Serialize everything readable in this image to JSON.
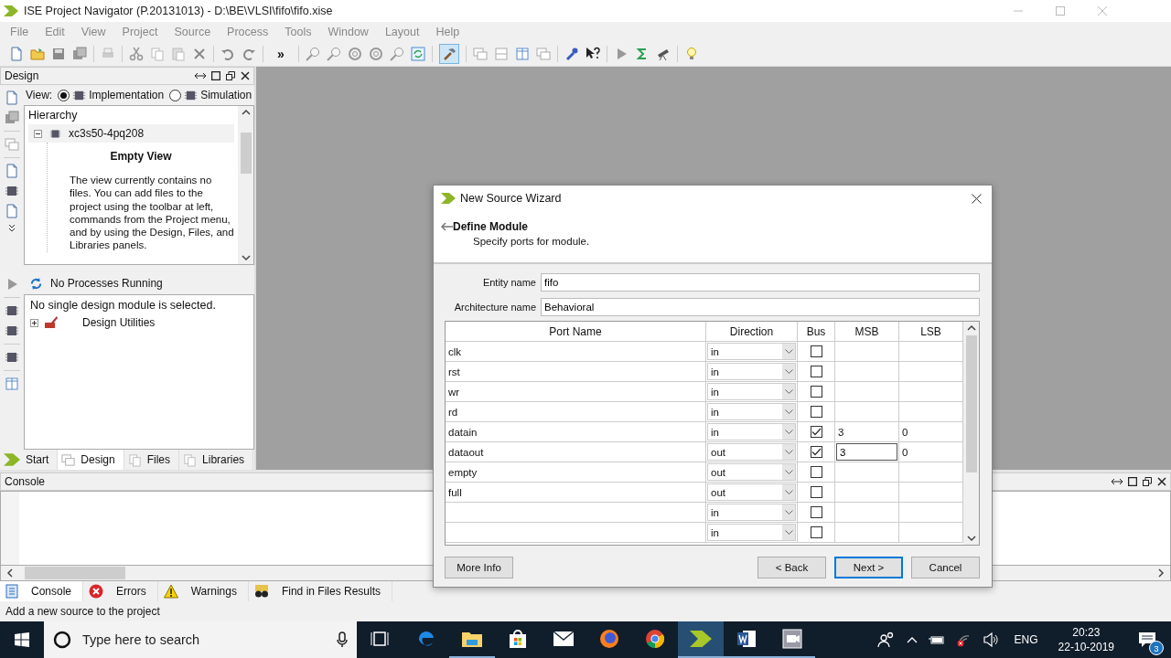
{
  "window": {
    "title": "ISE Project Navigator (P.20131013) - D:\\BE\\VLSI\\fifo\\fifo.xise"
  },
  "menu": [
    "File",
    "Edit",
    "View",
    "Project",
    "Source",
    "Process",
    "Tools",
    "Window",
    "Layout",
    "Help"
  ],
  "toolbar": {
    "overflow": "»"
  },
  "design_panel": {
    "title": "Design",
    "view_label": "View:",
    "view_options": [
      {
        "label": "Implementation",
        "selected": true
      },
      {
        "label": "Simulation",
        "selected": false
      }
    ],
    "hierarchy": {
      "title": "Hierarchy",
      "root": {
        "label": "xc3s50-4pq208",
        "expanded": true
      }
    },
    "empty_view": {
      "title": "Empty View",
      "text": "The view currently contains no files. You can add files to the project using the toolbar at left, commands from the Project menu, and by using the Design, Files, and Libraries panels."
    }
  },
  "processes": {
    "status": "No Processes Running",
    "message": "No single design module is selected.",
    "items": [
      {
        "label": "Design Utilities",
        "expanded": false
      }
    ]
  },
  "panel_tabs": [
    {
      "label": "Start",
      "selected": false
    },
    {
      "label": "Design",
      "selected": true
    },
    {
      "label": "Files",
      "selected": false
    },
    {
      "label": "Libraries",
      "selected": false
    }
  ],
  "console": {
    "title": "Console"
  },
  "console_tabs": [
    {
      "label": "Console",
      "selected": true
    },
    {
      "label": "Errors",
      "selected": false
    },
    {
      "label": "Warnings",
      "selected": false
    },
    {
      "label": "Find in Files Results",
      "selected": false
    }
  ],
  "status_bar": "Add a new source to the project",
  "dialog": {
    "title": "New Source Wizard",
    "page_title": "Define Module",
    "page_subtitle": "Specify ports for module.",
    "fields": [
      {
        "label": "Entity name",
        "value": "fifo"
      },
      {
        "label": "Architecture name",
        "value": "Behavioral"
      }
    ],
    "columns": [
      "Port Name",
      "Direction",
      "Bus",
      "MSB",
      "LSB"
    ],
    "rows": [
      {
        "port_name": "clk",
        "direction": "in",
        "bus": false,
        "msb_editing": false
      },
      {
        "port_name": "rst",
        "direction": "in",
        "bus": false,
        "msb_editing": false
      },
      {
        "port_name": "wr",
        "direction": "in",
        "bus": false,
        "msb_editing": false
      },
      {
        "port_name": "rd",
        "direction": "in",
        "bus": false,
        "msb_editing": false
      },
      {
        "port_name": "datain",
        "direction": "in",
        "bus": true,
        "msb": "3",
        "lsb": "0",
        "msb_editing": false
      },
      {
        "port_name": "dataout",
        "direction": "out",
        "bus": true,
        "msb": "3",
        "lsb": "0",
        "msb_editing": true
      },
      {
        "port_name": "empty",
        "direction": "out",
        "bus": false,
        "msb_editing": false
      },
      {
        "port_name": "full",
        "direction": "out",
        "bus": false,
        "msb_editing": false
      },
      {
        "direction": "in",
        "bus": false,
        "msb_editing": false
      },
      {
        "direction": "in",
        "bus": false,
        "msb_editing": false
      }
    ],
    "buttons": [
      {
        "label": "More Info",
        "default": false
      },
      {
        "label": "< Back",
        "default": false
      },
      {
        "label": "Next >",
        "default": true
      },
      {
        "label": "Cancel",
        "default": false
      }
    ]
  },
  "taskbar": {
    "search_placeholder": "Type here to search",
    "apps": [
      {
        "kind": "task-view",
        "running": false,
        "active": false
      },
      {
        "kind": "edge",
        "running": false,
        "active": false
      },
      {
        "kind": "explorer",
        "running": true,
        "active": false
      },
      {
        "kind": "store",
        "running": false,
        "active": false
      },
      {
        "kind": "mail",
        "running": false,
        "active": false
      },
      {
        "kind": "firefox",
        "running": false,
        "active": false
      },
      {
        "kind": "chrome",
        "running": false,
        "active": false
      },
      {
        "kind": "ise",
        "running": true,
        "active": true
      },
      {
        "kind": "word",
        "running": true,
        "active": false
      },
      {
        "kind": "media",
        "running": true,
        "active": false
      }
    ],
    "language": "ENG",
    "time": "20:23",
    "date": "22-10-2019",
    "notification_count": "3"
  }
}
